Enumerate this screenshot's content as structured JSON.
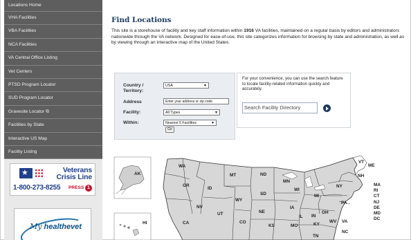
{
  "sidebar": {
    "items": [
      {
        "label": "Locations Home",
        "ext": ""
      },
      {
        "label": "VHA Facilities",
        "ext": ""
      },
      {
        "label": "VBA Facilities",
        "ext": ""
      },
      {
        "label": "NCA Facilities",
        "ext": ""
      },
      {
        "label": "VA Central Office Listing",
        "ext": ""
      },
      {
        "label": "Vet Centers",
        "ext": ""
      },
      {
        "label": "PTSD Program Locator",
        "ext": ""
      },
      {
        "label": "SUD Program Locator",
        "ext": ""
      },
      {
        "label": "Gravesite Locator",
        "ext": "⧉"
      },
      {
        "label": "Facilities by State",
        "ext": ""
      },
      {
        "label": "Interactive US Map",
        "ext": ""
      },
      {
        "label": "Facility Listing",
        "ext": ""
      }
    ]
  },
  "crisis_line": {
    "line1": "Veterans",
    "line2": "Crisis Line",
    "phone": "1-800-273-8255",
    "press": "PRESS",
    "press_num": "1",
    "flag_icon": "flag-star-icon",
    "brand_color": "#1f3f8a",
    "accent_color": "#c8102e"
  },
  "healthevet": {
    "my": "My",
    "text": "healthevet"
  },
  "main": {
    "title": "Find Locations",
    "intro_pre": "This site is a storehouse of facility and key staff information within ",
    "intro_count": "1916",
    "intro_post": " VA facilities, maintained on a regular basis by editors and administrators nationwide through the VA network. Designed for ease-of-use, this site categorizes information for browsing by state and administration, as well as by viewing through an interactive map of the United States."
  },
  "search_form": {
    "country_label": "Country / Territory:",
    "country_value": "USA",
    "address_label": "Address",
    "address_placeholder": "Enter your address or zip code",
    "facility_label": "Facility:",
    "facility_value": "All Types",
    "within_label": "Within:",
    "within_value": "Nearest 5 Facilities",
    "go_label": "Go"
  },
  "directory": {
    "text": "For your convenience, you can use the search feature to locate facility-related information quickly and accurately.",
    "placeholder": "Search Facility Directory",
    "go_icon": "circle-arrow-right-icon"
  },
  "map": {
    "state_labels": [
      "WA",
      "MT",
      "ND",
      "MN",
      "VT",
      "ME",
      "OR",
      "ID",
      "SD",
      "WI",
      "NY",
      "NH",
      "MA",
      "RI",
      "CT",
      "NJ",
      "DE",
      "MD",
      "DC",
      "WY",
      "MI",
      "PA",
      "IA",
      "NE",
      "IL",
      "IN",
      "OH",
      "NV",
      "UT",
      "CO",
      "KS",
      "MO",
      "KY",
      "WV",
      "VA",
      "CA",
      "TN",
      "NC",
      "AK",
      "HI"
    ]
  }
}
